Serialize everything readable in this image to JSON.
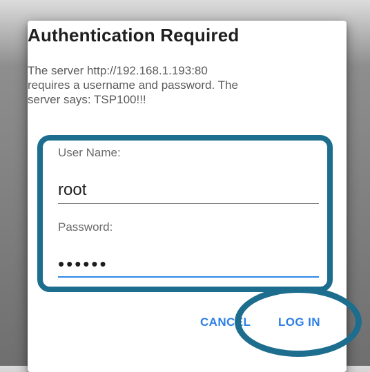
{
  "dialog": {
    "title": "Authentication Required",
    "message_lines": [
      "The server http://192.168.1.193:80",
      "requires a username and password. The",
      "server says: TSP100!!!"
    ]
  },
  "form": {
    "username_label": "User Name:",
    "username_value": "root",
    "password_label": "Password:",
    "password_value": "••••••"
  },
  "buttons": {
    "cancel_label": "CANCEL",
    "login_label": "LOG IN"
  },
  "colors": {
    "accent": "#2c7fe6",
    "highlight": "#1d6d8f"
  }
}
